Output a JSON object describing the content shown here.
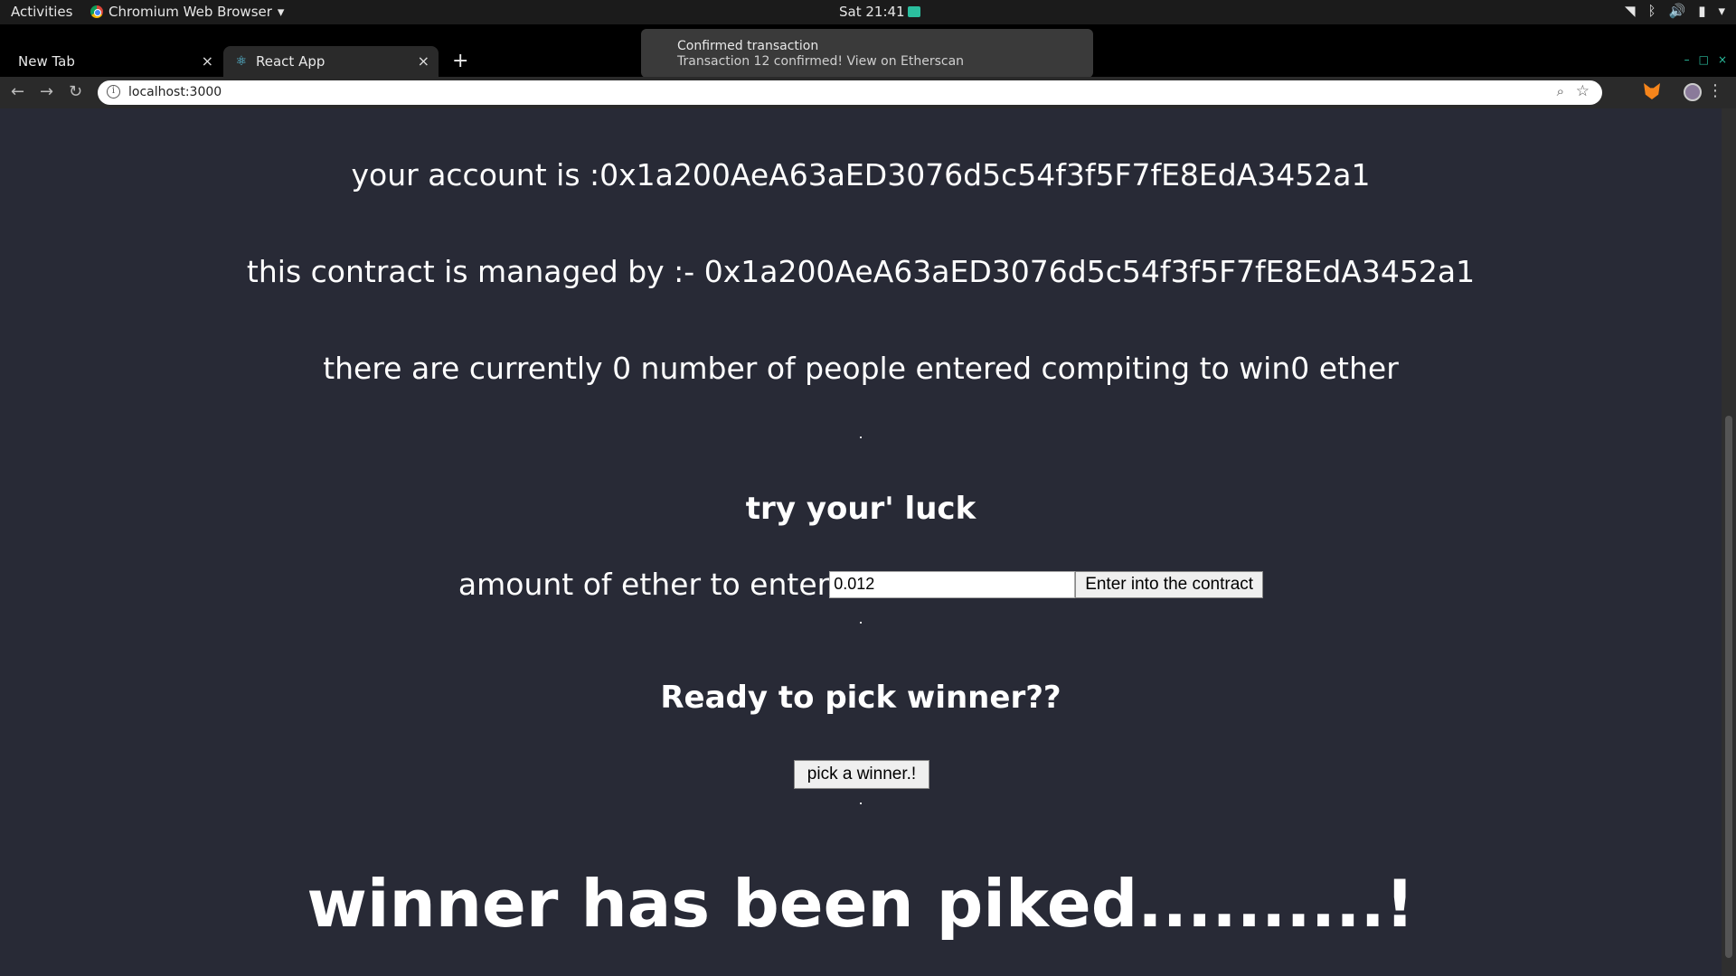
{
  "topbar": {
    "activities": "Activities",
    "app_name": "Chromium Web Browser",
    "app_caret": "▾",
    "clock": "Sat 21:41",
    "tray_icons": [
      "wifi-icon",
      "bluetooth-icon",
      "volume-icon",
      "battery-icon",
      "power-caret"
    ],
    "wifi": "◥",
    "bluetooth": "ᛒ",
    "volume": "🔊",
    "battery": "▮",
    "power": "▾"
  },
  "tabs": [
    {
      "title": "New Tab",
      "close": "×"
    },
    {
      "title": "React App",
      "close": "×",
      "favicon": "react-icon"
    }
  ],
  "newtab": "+",
  "window_controls": {
    "minimize": "–",
    "maximize": "□",
    "close": "×"
  },
  "toolbar": {
    "back": "←",
    "forward": "→",
    "reload": "↻",
    "info": "i",
    "url": "localhost:3000",
    "zoom": "⌕",
    "star": "☆",
    "menu": "⋮"
  },
  "toast": {
    "title": "Confirmed transaction",
    "message": "Transaction 12 confirmed! View on Etherscan"
  },
  "page": {
    "account_line": "your account is :0x1a200AeA63aED3076d5c54f3f5F7fE8EdA3452a1",
    "manager_line": "this contract is managed by :- 0x1a200AeA63aED3076d5c54f3f5F7fE8EdA3452a1",
    "players_line": "there are currently 0 number of people entered compiting to win0 ether",
    "dot": ".",
    "luck_heading": "try your' luck",
    "amount_label": "amount of ether to enter",
    "amount_value": "0.012",
    "enter_button": "Enter into the contract",
    "pick_heading": "Ready to pick winner??",
    "pick_button": "pick a winner.!",
    "result_message": "winner has been piked..........!"
  },
  "colors": {
    "page_background": "#282a36",
    "text": "#ffffff",
    "accent": "#2bbf9f"
  }
}
